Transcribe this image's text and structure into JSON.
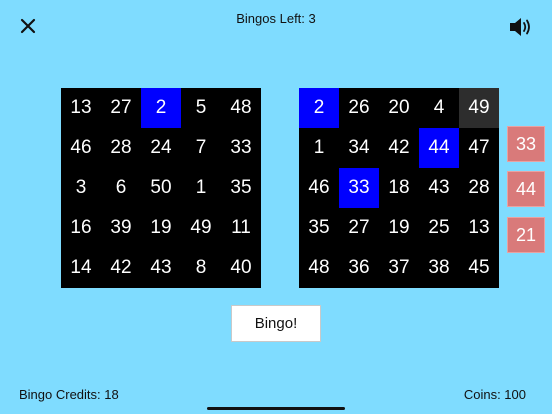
{
  "header": {
    "bingos_left": "Bingos Left: 3"
  },
  "left_card": [
    [
      {
        "n": "13"
      },
      {
        "n": "27"
      },
      {
        "n": "2",
        "marked": true
      },
      {
        "n": "5"
      },
      {
        "n": "48"
      }
    ],
    [
      {
        "n": "46"
      },
      {
        "n": "28"
      },
      {
        "n": "24"
      },
      {
        "n": "7"
      },
      {
        "n": "33"
      }
    ],
    [
      {
        "n": "3"
      },
      {
        "n": "6"
      },
      {
        "n": "50"
      },
      {
        "n": "1"
      },
      {
        "n": "35"
      }
    ],
    [
      {
        "n": "16"
      },
      {
        "n": "39"
      },
      {
        "n": "19"
      },
      {
        "n": "49"
      },
      {
        "n": "11"
      }
    ],
    [
      {
        "n": "14"
      },
      {
        "n": "42"
      },
      {
        "n": "43"
      },
      {
        "n": "8"
      },
      {
        "n": "40"
      }
    ]
  ],
  "right_card": [
    [
      {
        "n": "2",
        "marked": true
      },
      {
        "n": "26"
      },
      {
        "n": "20"
      },
      {
        "n": "4"
      },
      {
        "n": "49",
        "highlight": true
      }
    ],
    [
      {
        "n": "1"
      },
      {
        "n": "34"
      },
      {
        "n": "42"
      },
      {
        "n": "44",
        "marked": true
      },
      {
        "n": "47"
      }
    ],
    [
      {
        "n": "46"
      },
      {
        "n": "33",
        "marked": true
      },
      {
        "n": "18"
      },
      {
        "n": "43"
      },
      {
        "n": "28"
      }
    ],
    [
      {
        "n": "35"
      },
      {
        "n": "27"
      },
      {
        "n": "19"
      },
      {
        "n": "25"
      },
      {
        "n": "13"
      }
    ],
    [
      {
        "n": "48"
      },
      {
        "n": "36"
      },
      {
        "n": "37"
      },
      {
        "n": "38"
      },
      {
        "n": "45"
      }
    ]
  ],
  "called_numbers": [
    "33",
    "44",
    "21"
  ],
  "bingo_button": "Bingo!",
  "footer": {
    "credits": "Bingo Credits: 18",
    "coins": "Coins: 100"
  },
  "colors": {
    "background": "#7fdcff",
    "marked": "#0000ff",
    "called_ball": "#d97a7a"
  },
  "icons": {
    "close": "close-icon",
    "sound": "speaker-icon"
  }
}
